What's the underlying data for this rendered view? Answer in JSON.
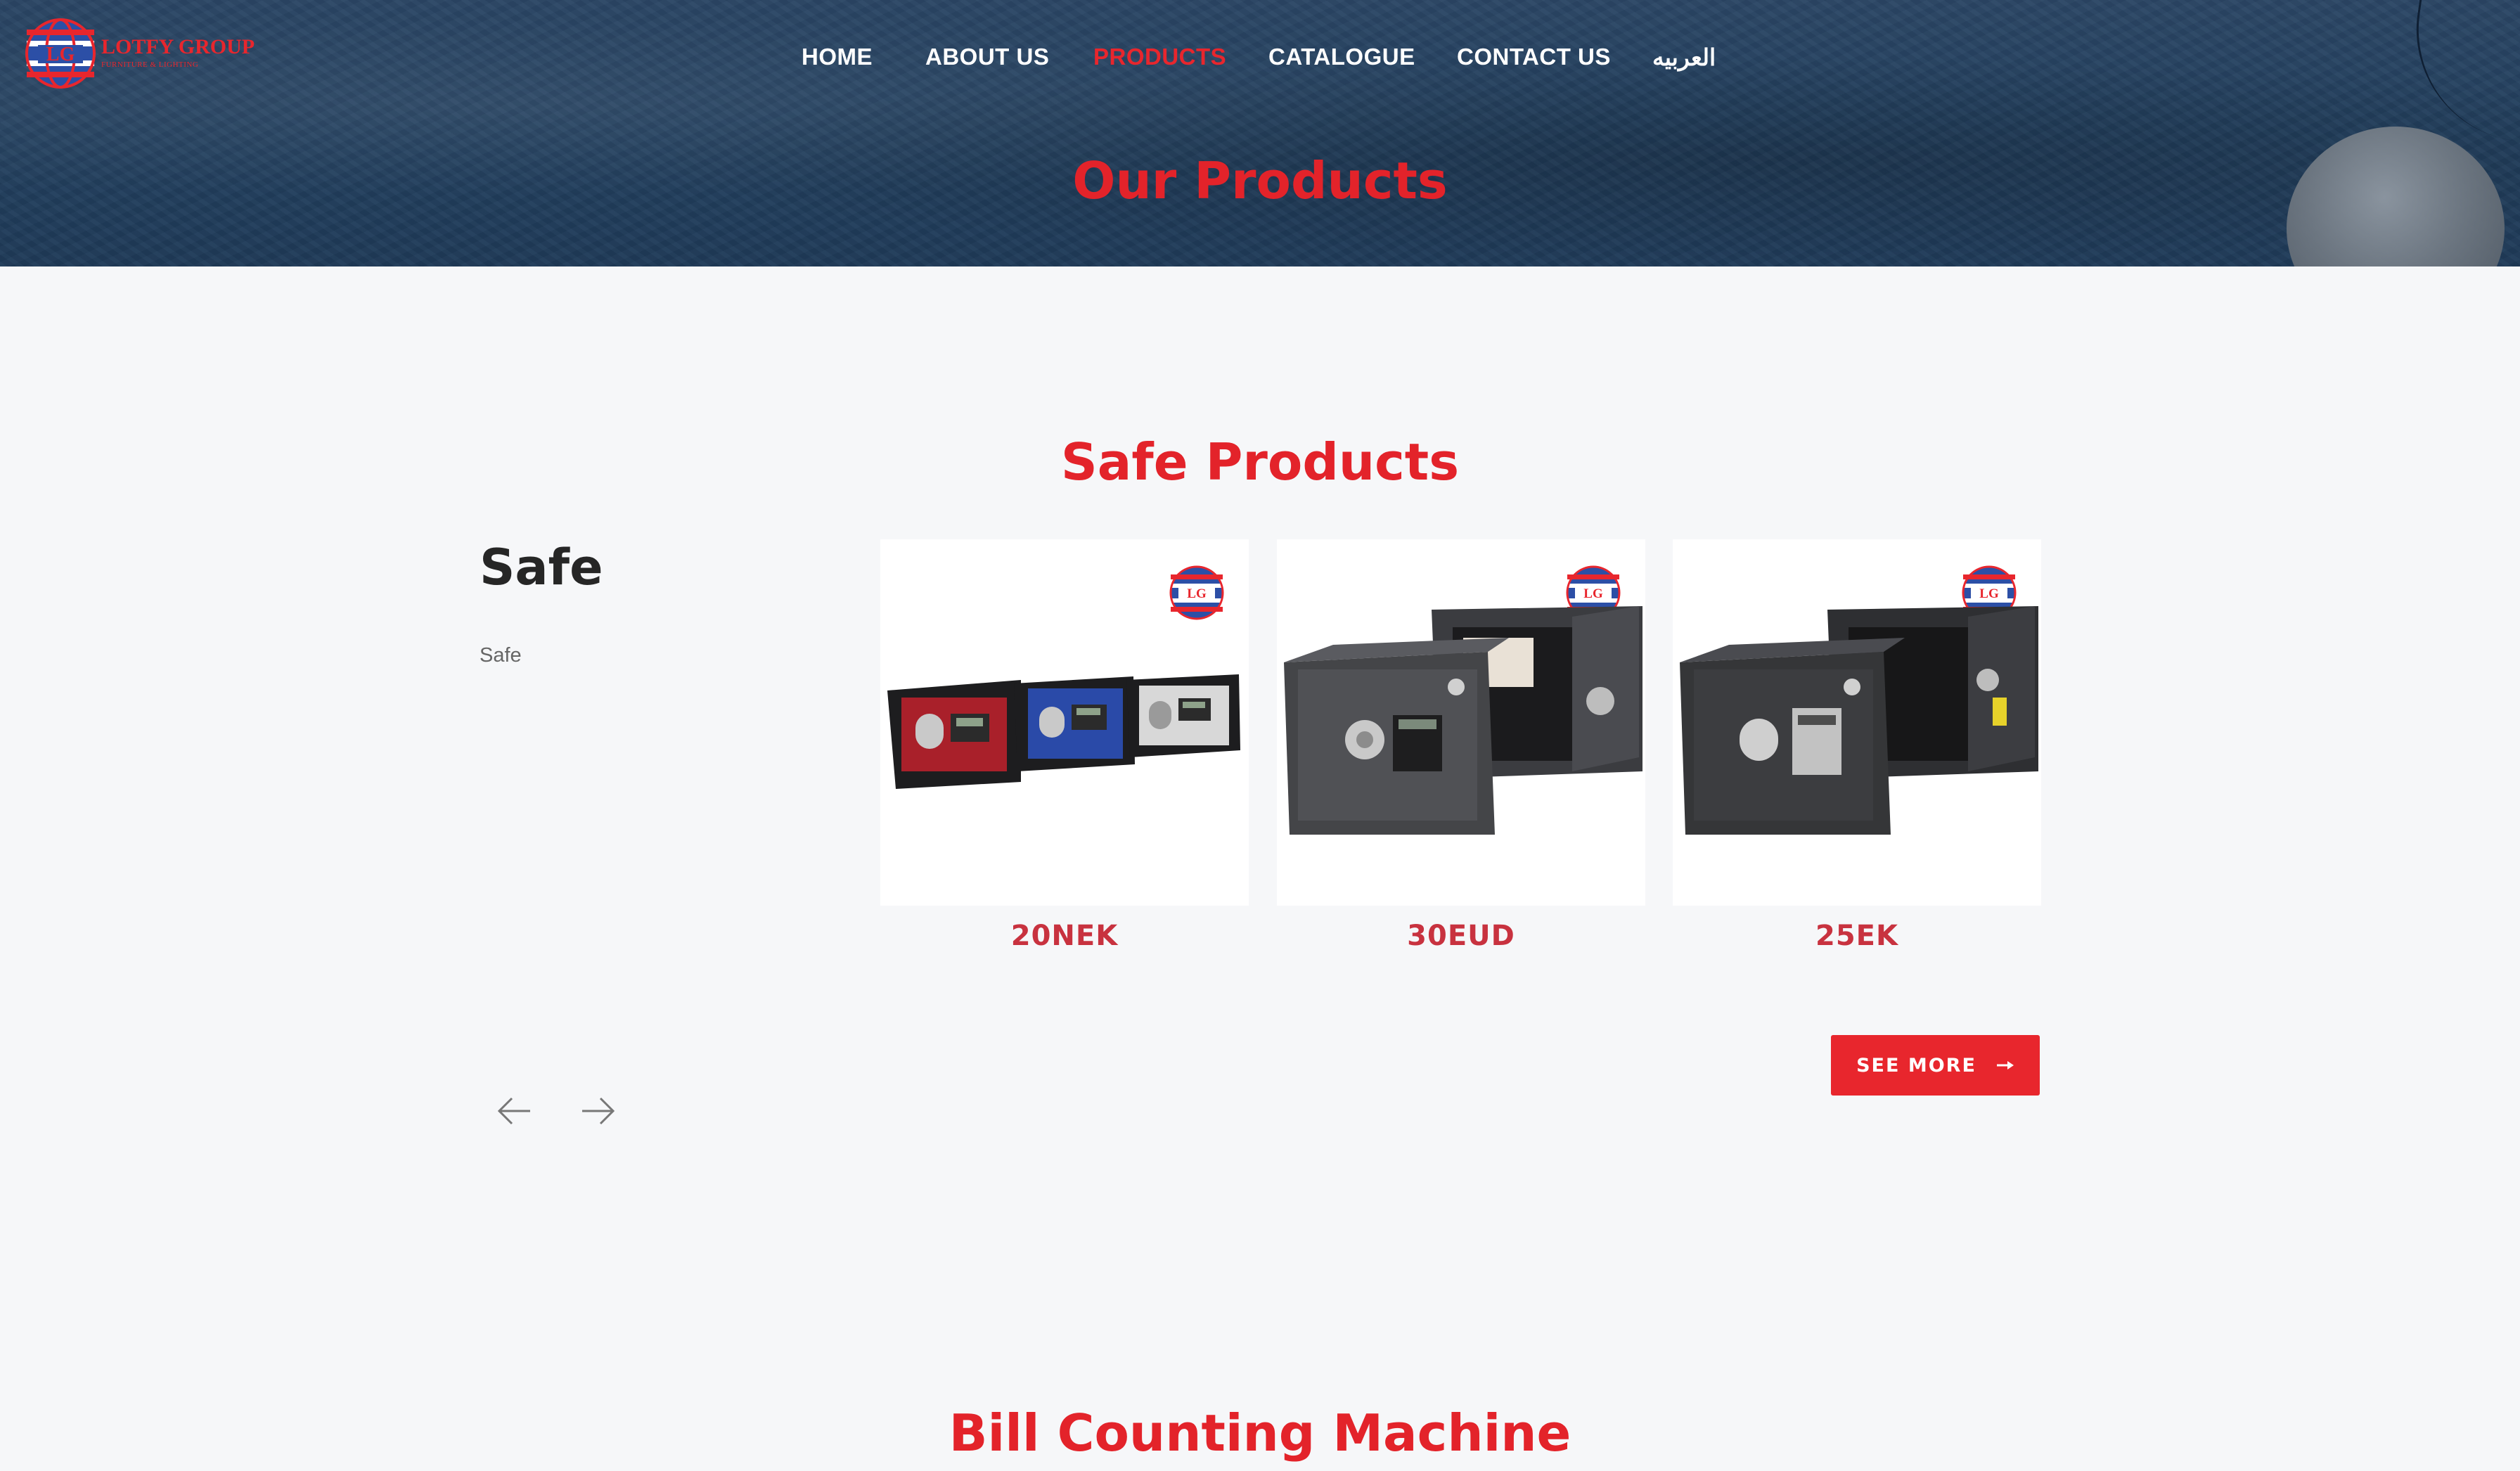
{
  "brand": {
    "logo_letters": "LG",
    "name": "LOTFY GROUP",
    "tagline": "FURNITURE & LIGHTING"
  },
  "nav": {
    "items": [
      {
        "label": "HOME",
        "active": false
      },
      {
        "label": "ABOUT US",
        "active": false
      },
      {
        "label": "PRODUCTS",
        "active": true
      },
      {
        "label": "CATALOGUE",
        "active": false
      },
      {
        "label": "CONTACT US",
        "active": false
      },
      {
        "label": "العربيه",
        "active": false
      }
    ]
  },
  "hero": {
    "title": "Our Products"
  },
  "sections": [
    {
      "title": "Safe Products",
      "category_title": "Safe",
      "category_description": "Safe",
      "products": [
        {
          "name": "20NEK",
          "image": "three-safes-red-blue-white"
        },
        {
          "name": "30EUD",
          "image": "dark-safe-open-and-closed"
        },
        {
          "name": "25EK",
          "image": "black-safe-open-and-closed"
        }
      ],
      "prev_icon": "arrow-left-icon",
      "next_icon": "arrow-right-icon",
      "see_more_label": "SEE MORE",
      "see_more_icon": "long-arrow-right-icon"
    },
    {
      "title": "Bill Counting Machine"
    }
  ],
  "colors": {
    "accent_red": "#e8262d",
    "hero_blue": "#23405f",
    "page_background": "#f6f7f9"
  }
}
